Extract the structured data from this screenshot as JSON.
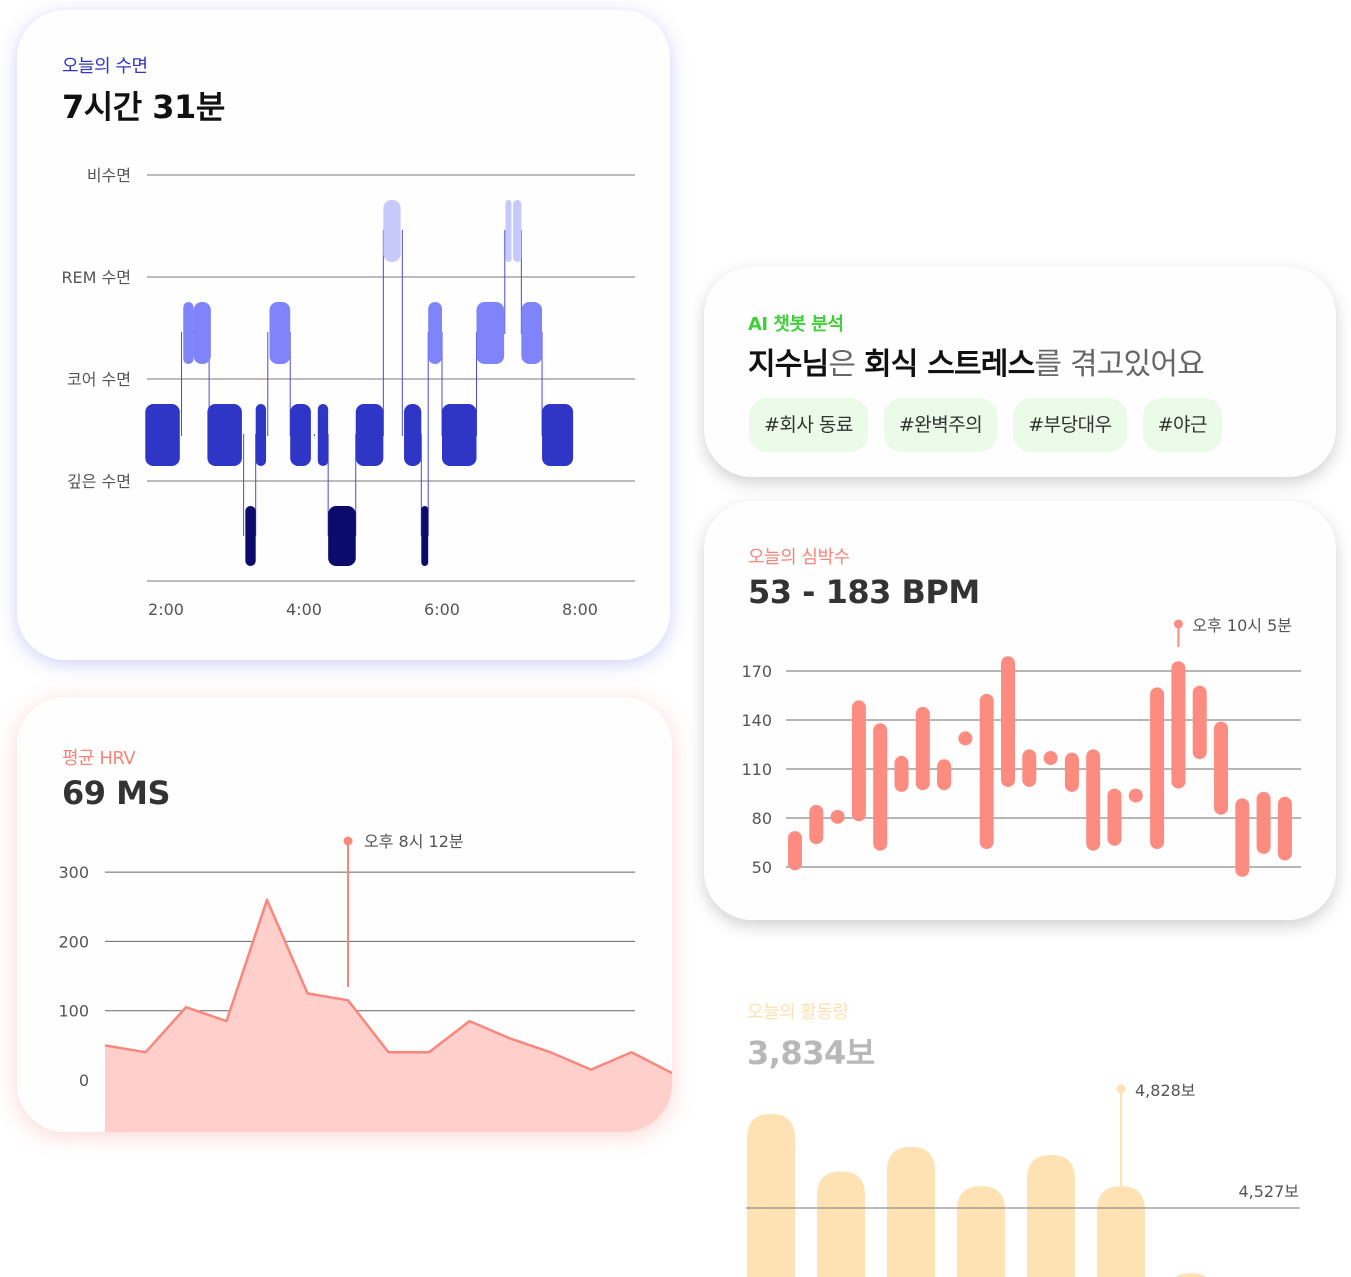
{
  "sleep": {
    "eyebrow": "오늘의 수면",
    "value": "7시간 31분",
    "colors": {
      "awake": "#c8c9fb",
      "rem": "#8084fa",
      "core": "#2f35c4",
      "deep": "#0a0b6b",
      "line": "#4a4ad4"
    }
  },
  "hrv": {
    "eyebrow": "평균 HRV",
    "value": "69 MS",
    "annotation": "오후 8시 12분",
    "color": "#f9877b",
    "fill": "#ffcfcb"
  },
  "ai": {
    "eyebrow": "AI 챗봇 분석",
    "headline": {
      "name": "지수님",
      "p1": "은 ",
      "topic": "회식 스트레스",
      "p2": "를 겪고있어요"
    },
    "tags": [
      "#회사 동료",
      "#완벽주의",
      "#부당대우",
      "#야근"
    ]
  },
  "heart": {
    "eyebrow": "오늘의 심박수",
    "value": "53 - 183 BPM",
    "annotation": "오후 10시 5분",
    "color": "#fc8b80"
  },
  "activity": {
    "eyebrow": "오늘의 활동량",
    "value": "3,834보",
    "annotation": "4,828보",
    "average_label": "4,527보",
    "color": "#fee2b3"
  },
  "chart_data": [
    {
      "type": "timeline",
      "yticks": [
        "비수면",
        "REM 수면",
        "코어 수면",
        "깊은 수면"
      ],
      "xticks": [
        "2:00",
        "4:00",
        "6:00",
        "8:00"
      ],
      "x_unit": "hours",
      "stages": [
        "awake",
        "rem",
        "core",
        "deep"
      ],
      "segments": [
        {
          "stage": "core",
          "start": 1.7,
          "end": 2.2
        },
        {
          "stage": "rem",
          "start": 2.25,
          "end": 2.4
        },
        {
          "stage": "rem",
          "start": 2.4,
          "end": 2.65
        },
        {
          "stage": "core",
          "start": 2.6,
          "end": 3.1
        },
        {
          "stage": "deep",
          "start": 3.15,
          "end": 3.3
        },
        {
          "stage": "core",
          "start": 3.3,
          "end": 3.45
        },
        {
          "stage": "rem",
          "start": 3.5,
          "end": 3.8
        },
        {
          "stage": "core",
          "start": 3.8,
          "end": 4.1
        },
        {
          "stage": "core",
          "start": 4.2,
          "end": 4.35
        },
        {
          "stage": "deep",
          "start": 4.35,
          "end": 4.75
        },
        {
          "stage": "core",
          "start": 4.75,
          "end": 5.15
        },
        {
          "stage": "awake",
          "start": 5.15,
          "end": 5.4
        },
        {
          "stage": "core",
          "start": 5.45,
          "end": 5.7
        },
        {
          "stage": "deep",
          "start": 5.7,
          "end": 5.8
        },
        {
          "stage": "rem",
          "start": 5.8,
          "end": 6.0
        },
        {
          "stage": "core",
          "start": 6.0,
          "end": 6.5
        },
        {
          "stage": "rem",
          "start": 6.5,
          "end": 6.9
        },
        {
          "stage": "awake",
          "start": 6.92,
          "end": 6.97
        },
        {
          "stage": "awake",
          "start": 7.03,
          "end": 7.15
        },
        {
          "stage": "rem",
          "start": 7.15,
          "end": 7.45
        },
        {
          "stage": "core",
          "start": 7.45,
          "end": 7.9
        }
      ]
    },
    {
      "type": "area",
      "y_ticks": [
        0,
        100,
        200,
        300
      ],
      "ylim": [
        -75,
        310
      ],
      "x": [
        0,
        1,
        2,
        3,
        4,
        5,
        6,
        7,
        8,
        9,
        10,
        11,
        12,
        13,
        14
      ],
      "values": [
        50,
        40,
        105,
        85,
        260,
        125,
        115,
        40,
        40,
        85,
        60,
        40,
        15,
        40,
        10
      ],
      "highlight_index": 6
    },
    {
      "type": "range-bar",
      "y_ticks": [
        50,
        80,
        110,
        140,
        170
      ],
      "ylim": [
        50,
        185
      ],
      "ranges": [
        [
          48,
          72
        ],
        [
          64,
          88
        ],
        [
          79,
          85
        ],
        [
          78,
          152
        ],
        [
          60,
          138
        ],
        [
          96,
          118
        ],
        [
          97,
          148
        ],
        [
          97,
          116
        ],
        [
          129,
          133
        ],
        [
          61,
          156
        ],
        [
          99,
          179
        ],
        [
          99,
          122
        ],
        [
          119,
          121
        ],
        [
          96,
          120
        ],
        [
          60,
          122
        ],
        [
          63,
          98
        ],
        [
          92,
          98
        ],
        [
          61,
          160
        ],
        [
          98,
          176
        ],
        [
          116,
          161
        ],
        [
          82,
          139
        ],
        [
          44,
          92
        ],
        [
          58,
          96
        ],
        [
          54,
          93
        ]
      ],
      "highlight_index": 18
    },
    {
      "type": "bar",
      "values": [
        5100,
        4750,
        4900,
        4660,
        4850,
        4660,
        4130
      ],
      "average": 4527,
      "highlight_index": 5,
      "ylim": [
        2700,
        5350
      ]
    }
  ]
}
